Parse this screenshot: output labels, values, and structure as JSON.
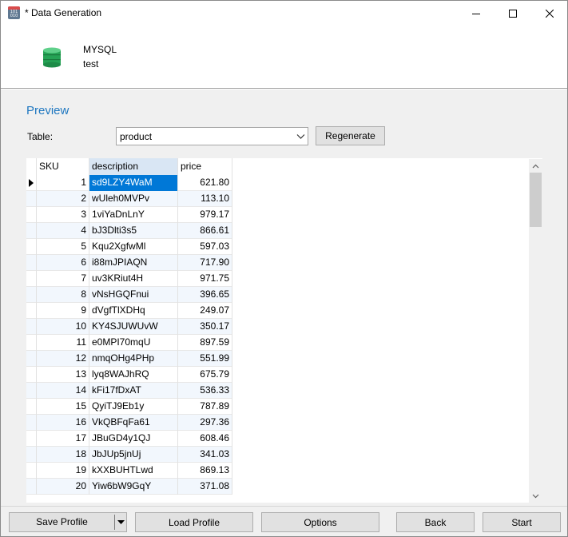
{
  "window": {
    "title": "* Data Generation"
  },
  "header": {
    "db_type": "MYSQL",
    "schema": "test"
  },
  "preview": {
    "section_title": "Preview",
    "table_label": "Table:",
    "table_value": "product",
    "regenerate_label": "Regenerate"
  },
  "grid": {
    "columns": [
      "SKU",
      "description",
      "price"
    ],
    "rows": [
      [
        "1",
        "sd9LZY4WaM",
        "621.80"
      ],
      [
        "2",
        "wUleh0MVPv",
        "113.10"
      ],
      [
        "3",
        "1viYaDnLnY",
        "979.17"
      ],
      [
        "4",
        "bJ3Dlti3s5",
        "866.61"
      ],
      [
        "5",
        "Kqu2XgfwMl",
        "597.03"
      ],
      [
        "6",
        "i88mJPIAQN",
        "717.90"
      ],
      [
        "7",
        "uv3KRiut4H",
        "971.75"
      ],
      [
        "8",
        "vNsHGQFnui",
        "396.65"
      ],
      [
        "9",
        "dVgfTlXDHq",
        "249.07"
      ],
      [
        "10",
        "KY4SJUWUvW",
        "350.17"
      ],
      [
        "11",
        "e0MPI70mqU",
        "897.59"
      ],
      [
        "12",
        "nmqOHg4PHp",
        "551.99"
      ],
      [
        "13",
        "lyq8WAJhRQ",
        "675.79"
      ],
      [
        "14",
        "kFi17fDxAT",
        "536.33"
      ],
      [
        "15",
        "QyiTJ9Eb1y",
        "787.89"
      ],
      [
        "16",
        "VkQBFqFa61",
        "297.36"
      ],
      [
        "17",
        "JBuGD4y1QJ",
        "608.46"
      ],
      [
        "18",
        "JbJUp5jnUj",
        "341.03"
      ],
      [
        "19",
        "kXXBUHTLwd",
        "869.13"
      ],
      [
        "20",
        "Yiw6bW9GqY",
        "371.08"
      ]
    ],
    "selected_row": 1,
    "selected_column": "description"
  },
  "footer": {
    "save_profile": "Save Profile",
    "load_profile": "Load Profile",
    "options": "Options",
    "back": "Back",
    "start": "Start"
  },
  "colors": {
    "accent": "#1e77c0",
    "selection": "#0078d7",
    "db_icon": "#2fae5a"
  },
  "icons": {
    "app": "data-generator-app-icon",
    "database": "database-icon"
  }
}
